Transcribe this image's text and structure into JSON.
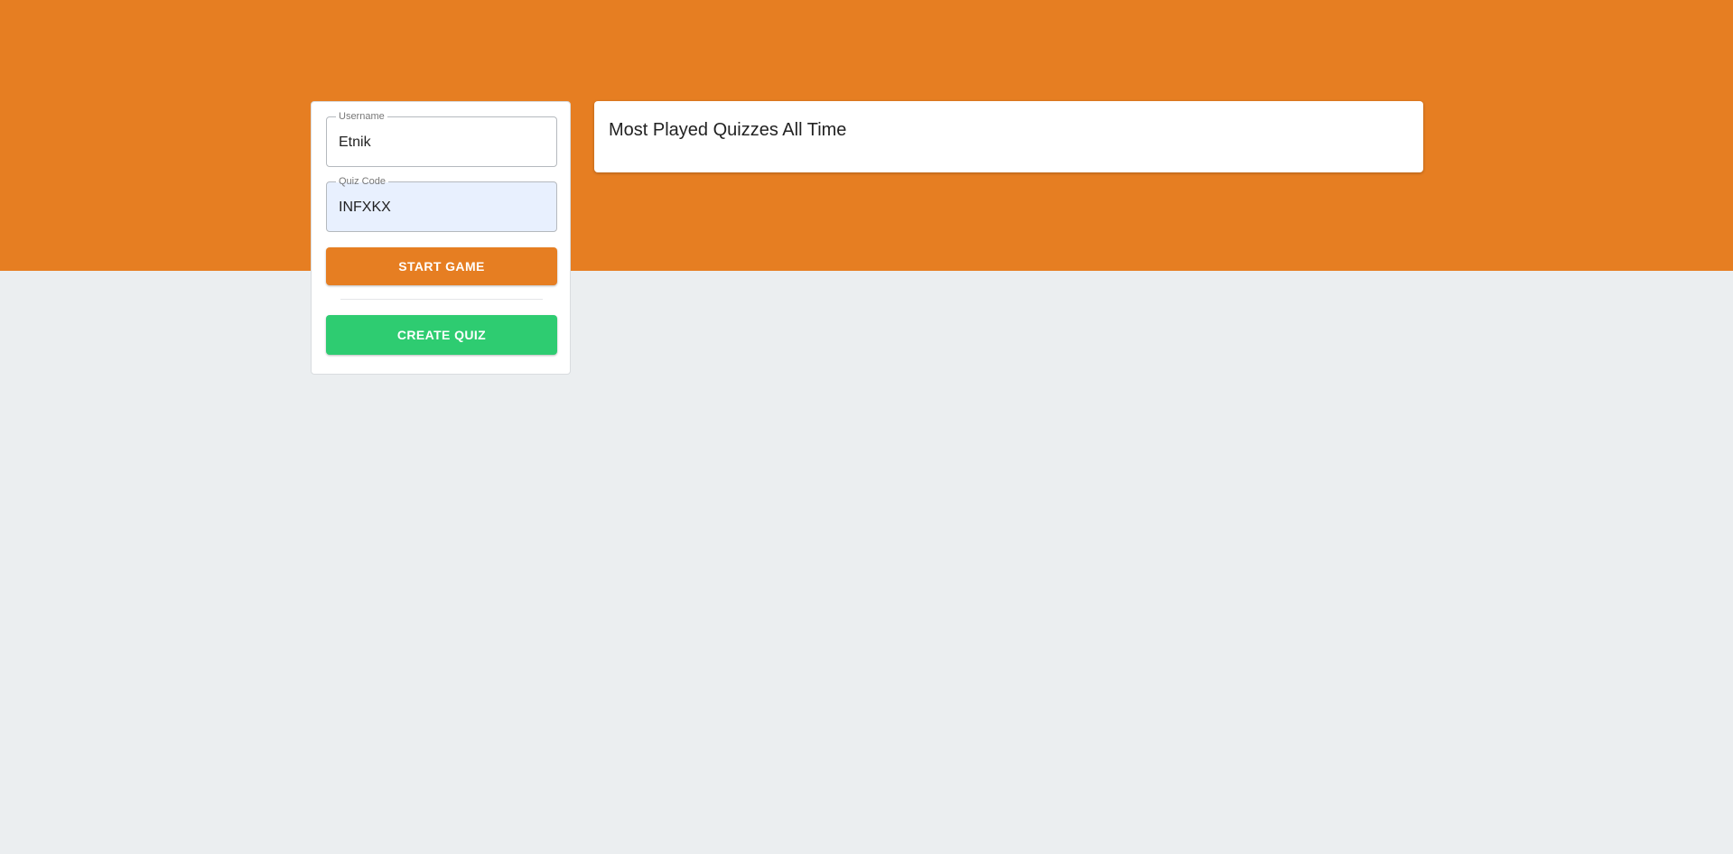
{
  "colors": {
    "accent": "#e67e22",
    "create": "#2ecc71",
    "background": "#ebeef0",
    "autofill": "#e8f0fe"
  },
  "join_form": {
    "username": {
      "label": "Username",
      "value": "Etnik"
    },
    "quiz_code": {
      "label": "Quiz Code",
      "value": "INFXKX"
    },
    "start_label": "START GAME",
    "create_label": "CREATE QUIZ"
  },
  "quizzes_panel": {
    "title": "Most Played Quizzes All Time"
  }
}
